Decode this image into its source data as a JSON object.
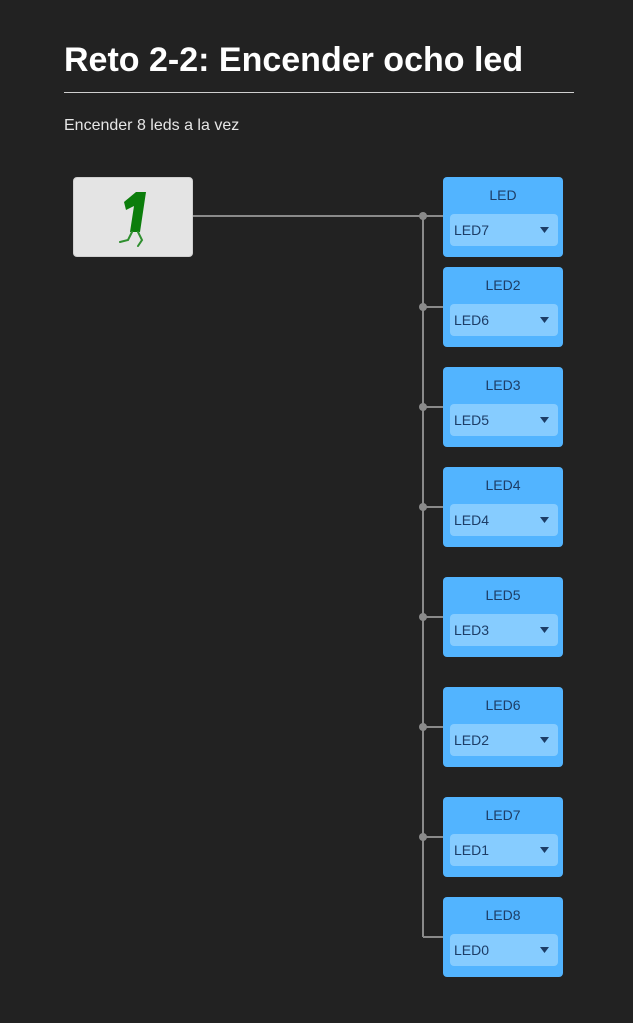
{
  "page": {
    "title": "Reto 2-2: Encender ocho led",
    "subtitle": "Encender 8 leds a la vez"
  },
  "start_block": {
    "icon": "start-figure-one-icon",
    "icon_color": "#0b7d0b"
  },
  "led_blocks": [
    {
      "label": "LED",
      "selected": "LED7"
    },
    {
      "label": "LED2",
      "selected": "LED6"
    },
    {
      "label": "LED3",
      "selected": "LED5"
    },
    {
      "label": "LED4",
      "selected": "LED4"
    },
    {
      "label": "LED5",
      "selected": "LED3"
    },
    {
      "label": "LED6",
      "selected": "LED2"
    },
    {
      "label": "LED7",
      "selected": "LED1"
    },
    {
      "label": "LED8",
      "selected": "LED0"
    }
  ],
  "colors": {
    "background": "#222222",
    "led_block": "#52b4ff",
    "led_select": "#86ccff",
    "start_block": "#e4e4e4",
    "wire": "#8a8a8a"
  }
}
